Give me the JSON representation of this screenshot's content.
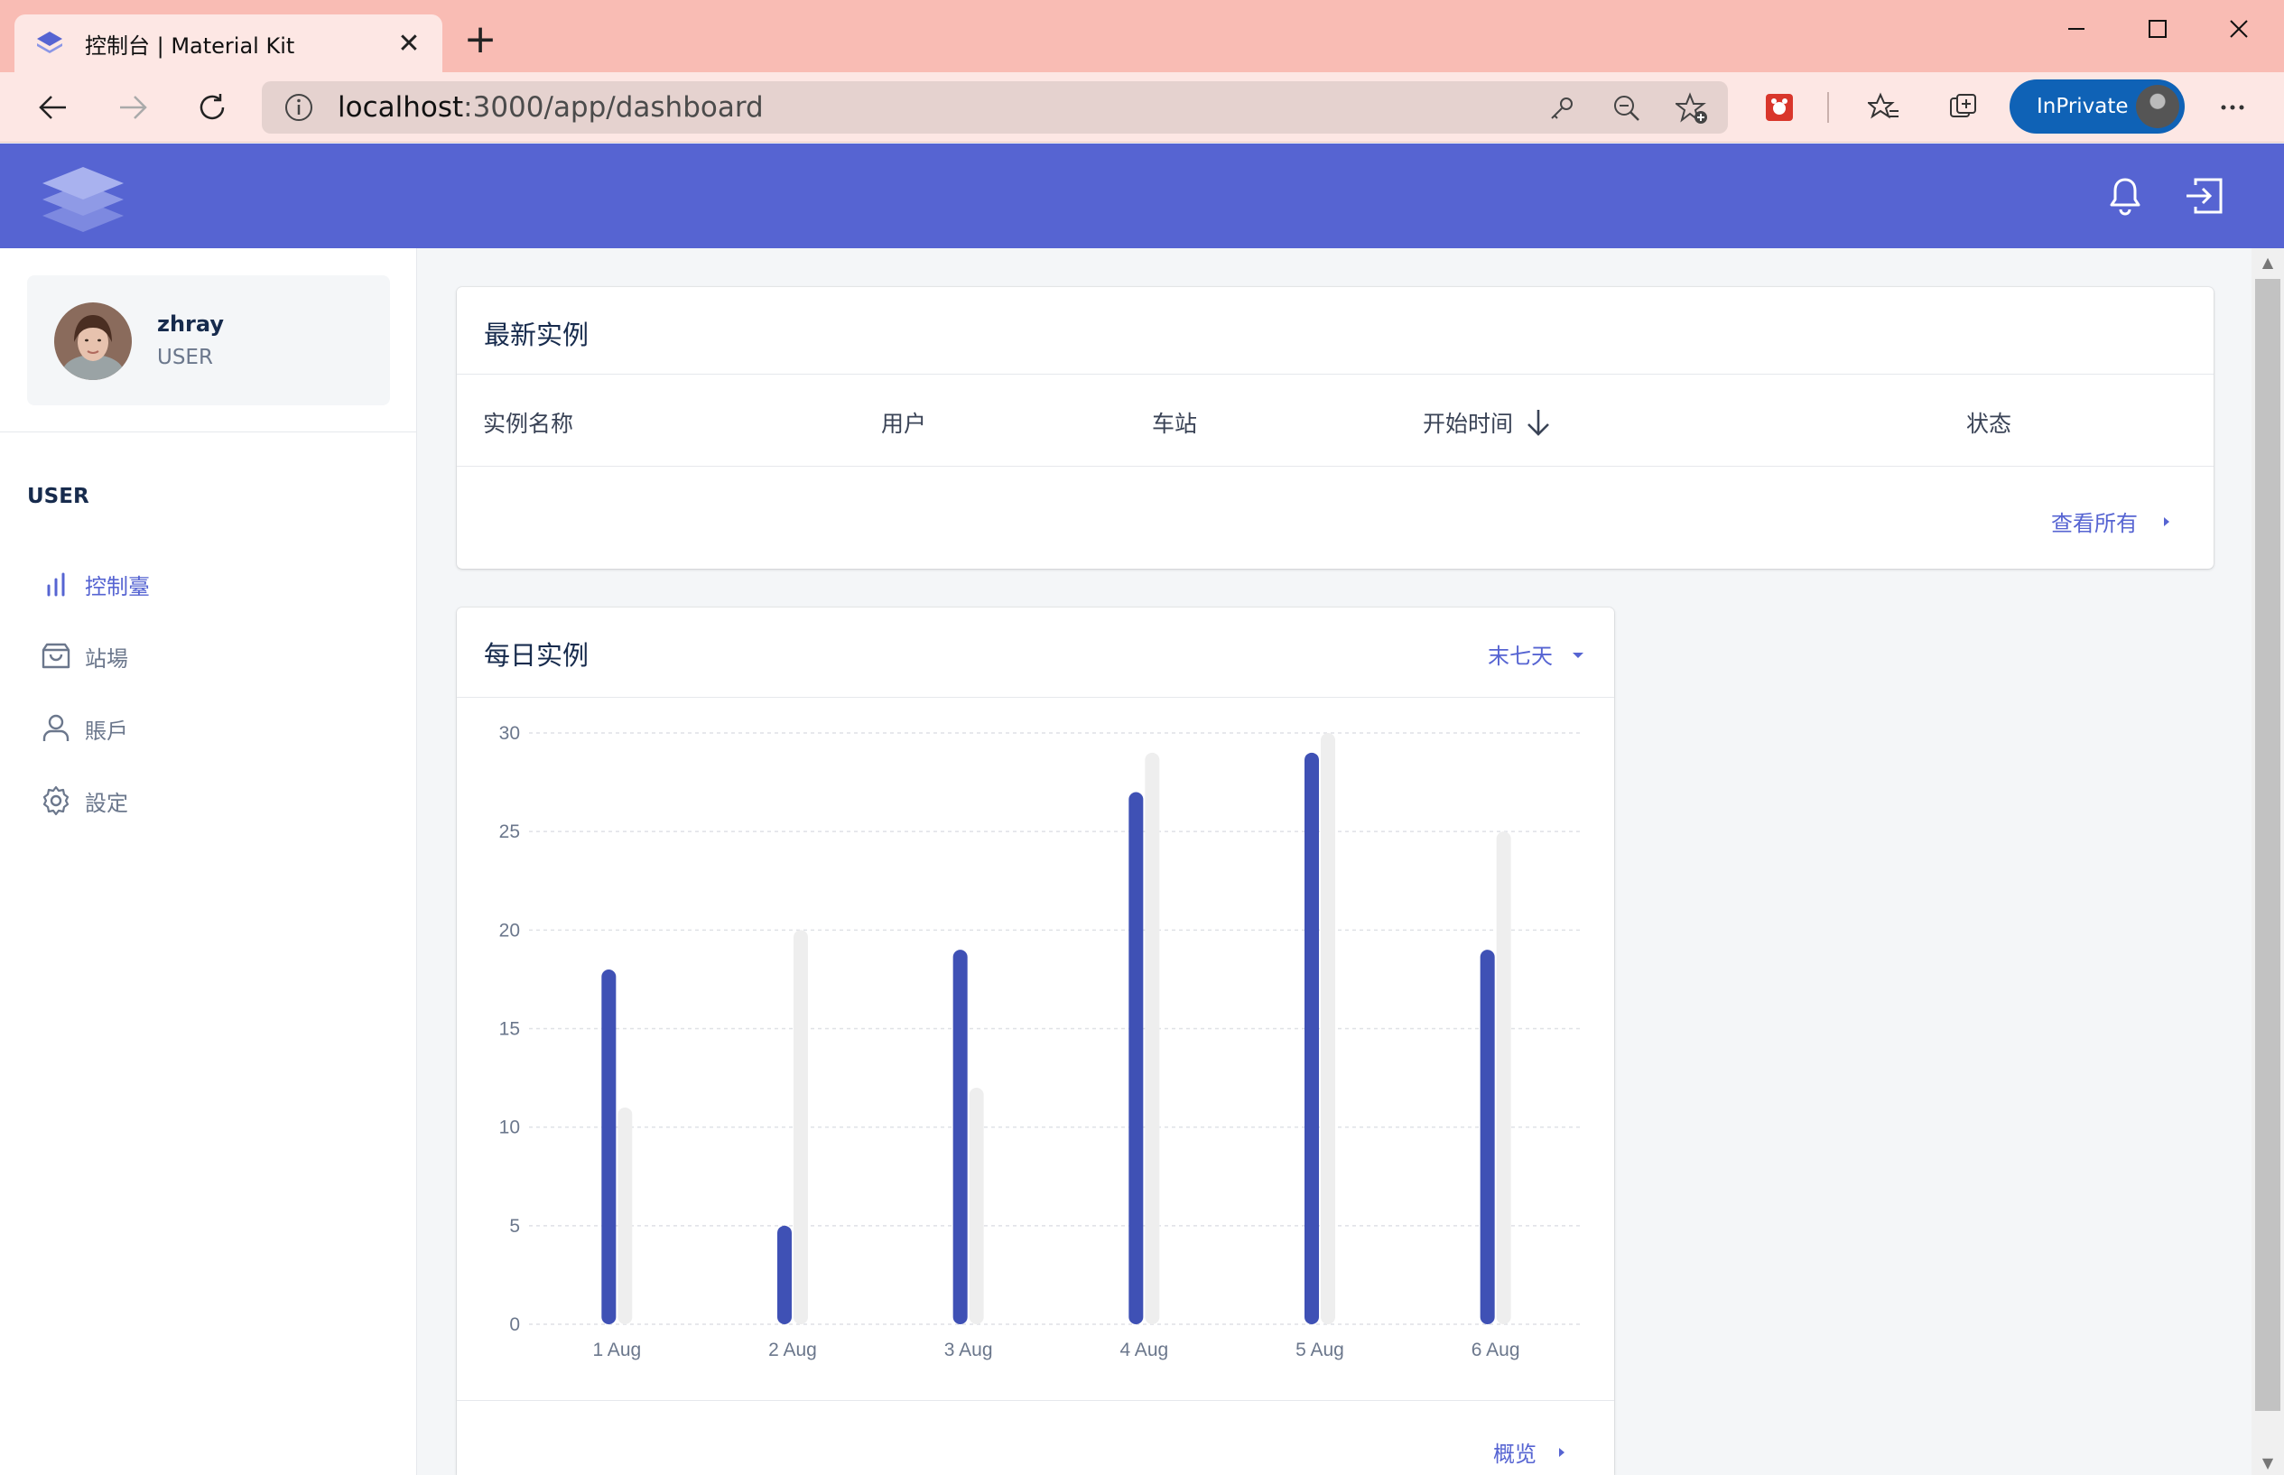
{
  "browser": {
    "tab_title": "控制台 | Material Kit",
    "url_host": "localhost",
    "url_path": ":3000/app/dashboard",
    "inprivate_label": "InPrivate"
  },
  "app": {
    "brand_color": "#5664d2",
    "profile": {
      "name": "zhray",
      "role": "USER"
    },
    "sidebar_section": "USER",
    "nav": [
      {
        "label": "控制臺",
        "icon": "bar-chart-icon",
        "active": true
      },
      {
        "label": "站場",
        "icon": "shopping-bag-icon",
        "active": false
      },
      {
        "label": "賬戶",
        "icon": "user-icon",
        "active": false
      },
      {
        "label": "設定",
        "icon": "settings-icon",
        "active": false
      }
    ]
  },
  "latest": {
    "title": "最新实例",
    "columns": [
      "实例名称",
      "用户",
      "车站",
      "开始时间",
      "状态"
    ],
    "view_all": "查看所有"
  },
  "daily": {
    "title": "每日实例",
    "range_label": "末七天",
    "overview": "概览"
  },
  "chart_data": {
    "type": "bar",
    "categories": [
      "1 Aug",
      "2 Aug",
      "3 Aug",
      "4 Aug",
      "5 Aug",
      "6 Aug"
    ],
    "series": [
      {
        "values": [
          18,
          5,
          19,
          27,
          29,
          19
        ],
        "color": "#3f51b5"
      },
      {
        "values": [
          11,
          20,
          12,
          29,
          30,
          25
        ],
        "color": "#eeeeee"
      }
    ],
    "yticks": [
      0,
      5,
      10,
      15,
      20,
      25,
      30
    ],
    "ylim": [
      0,
      30
    ],
    "grid": true
  }
}
